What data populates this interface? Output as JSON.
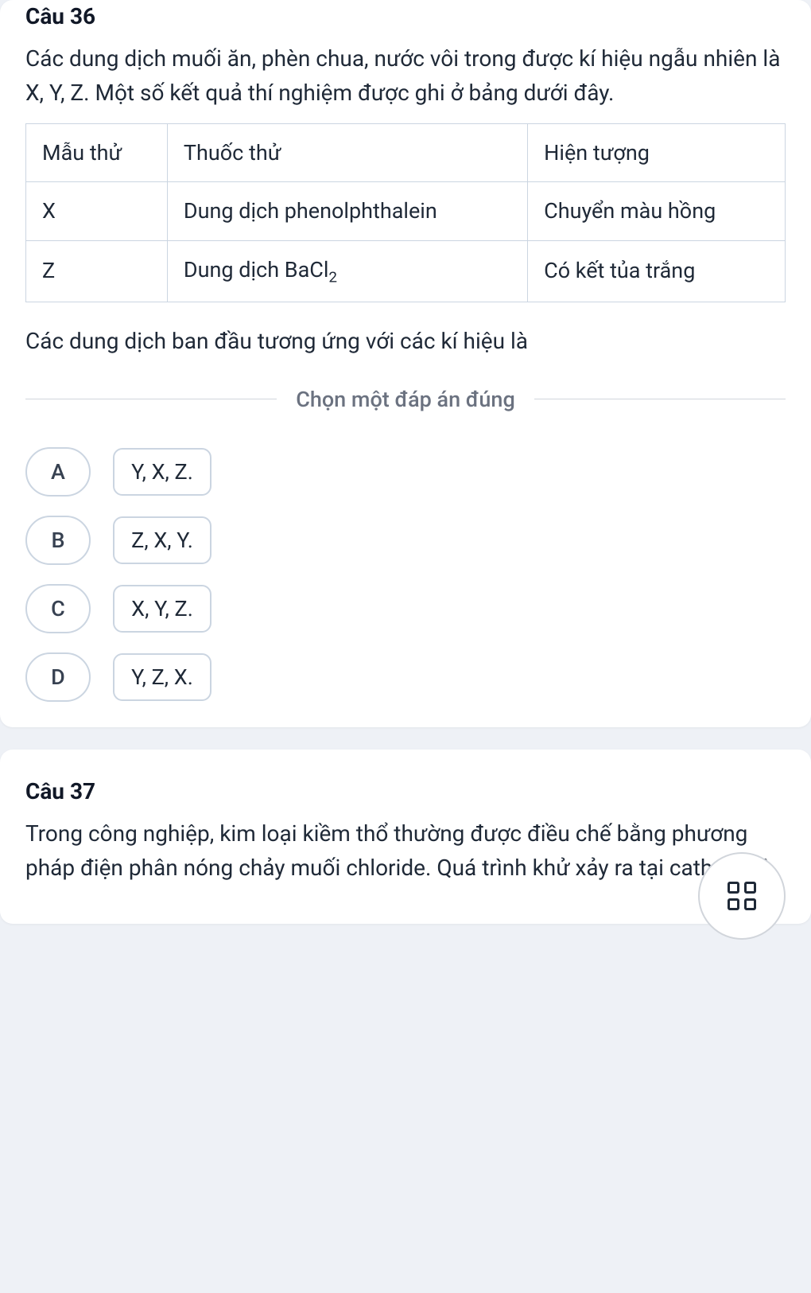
{
  "q36": {
    "title": "Câu 36",
    "text": "Các dung dịch muối ăn, phèn chua, nước vôi trong được kí hiệu ngẫu nhiên là X, Y, Z. Một số kết quả thí nghiệm được ghi ở bảng dưới đây.",
    "table": {
      "headers": [
        "Mẫu thử",
        "Thuốc thử",
        "Hiện tượng"
      ],
      "rows": [
        [
          "X",
          "Dung dịch phenolphthalein",
          "Chuyển màu hồng"
        ],
        [
          "Z",
          "Dung dịch BaCl",
          "Có kết tủa trắng"
        ]
      ],
      "bacl_sub": "2"
    },
    "subtext": "Các dung dịch ban đầu tương ứng với các kí hiệu là",
    "divider": "Chọn một đáp án đúng",
    "options": [
      {
        "letter": "A",
        "value": "Y, X, Z."
      },
      {
        "letter": "B",
        "value": "Z, X, Y."
      },
      {
        "letter": "C",
        "value": "X, Y, Z."
      },
      {
        "letter": "D",
        "value": "Y, Z, X."
      }
    ]
  },
  "q37": {
    "title": "Câu 37",
    "text": "Trong công nghiệp, kim loại kiềm thổ thường được điều chế bằng phương pháp điện phân nóng chảy muối chloride. Quá trình khử xảy ra tại cathode là"
  }
}
